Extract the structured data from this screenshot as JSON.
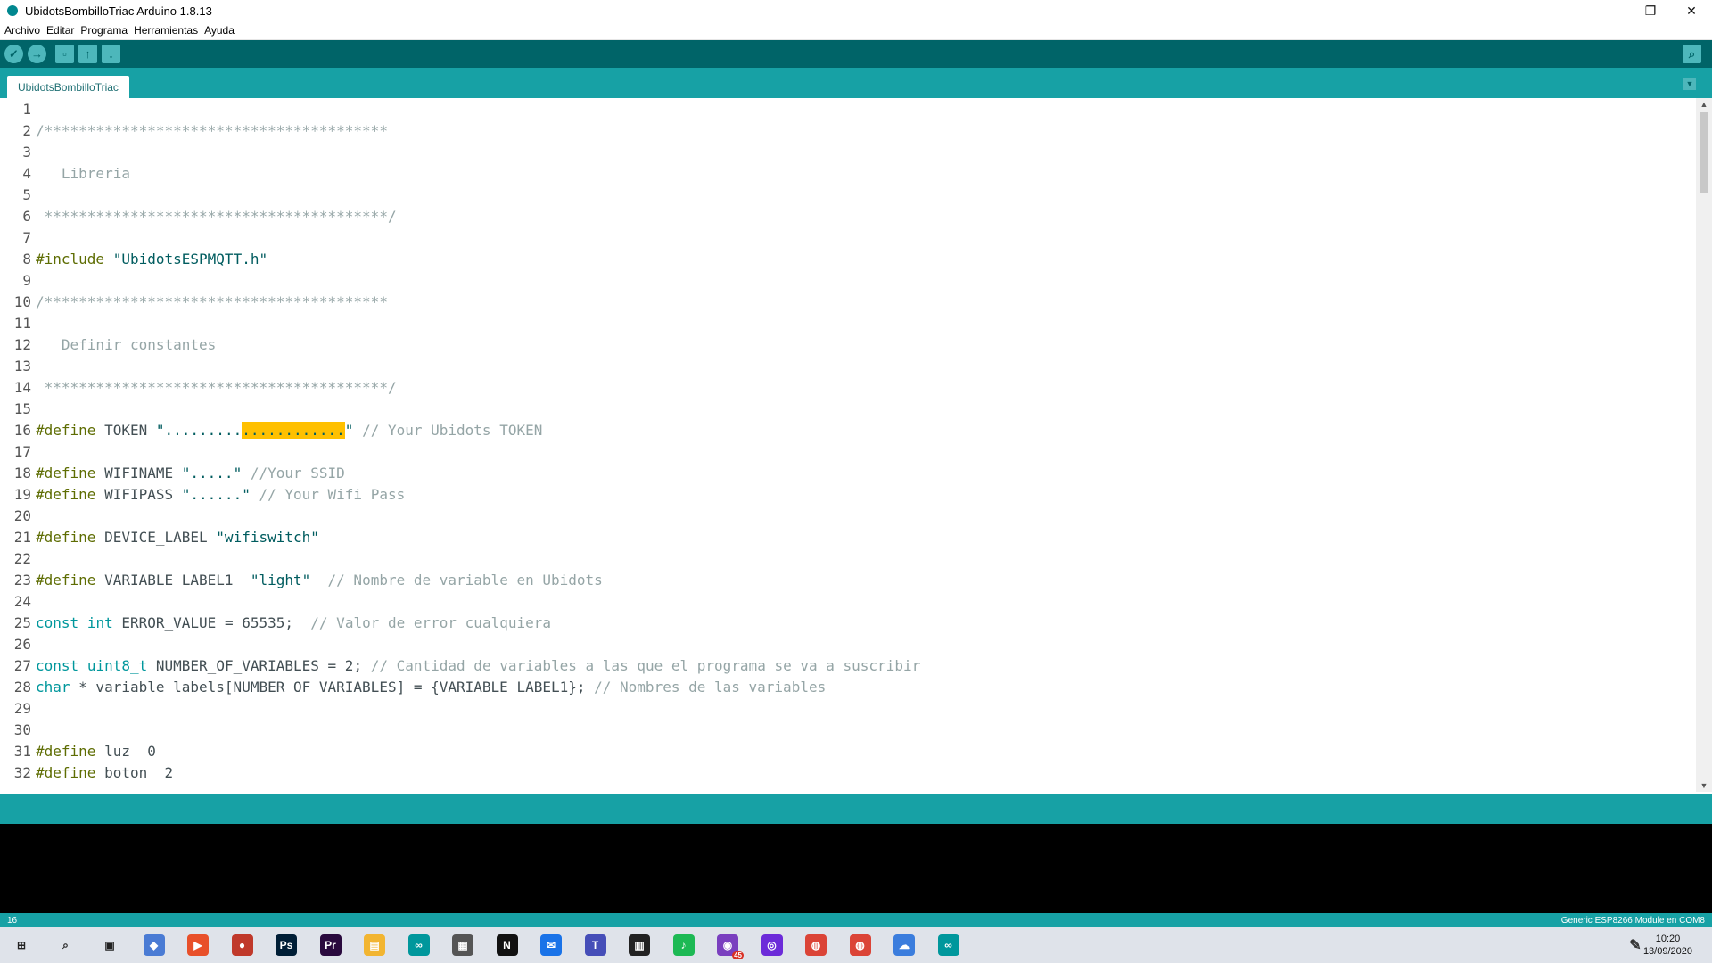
{
  "window": {
    "title": "UbidotsBombilloTriac Arduino 1.8.13",
    "controls": [
      "–",
      "❐",
      "✕"
    ]
  },
  "menu": [
    "Archivo",
    "Editar",
    "Programa",
    "Herramientas",
    "Ayuda"
  ],
  "toolbar": {
    "icons": [
      "verify-icon",
      "upload-icon",
      "new-icon",
      "open-icon",
      "save-icon",
      "serial-monitor-icon"
    ]
  },
  "tabs": [
    {
      "label": "UbidotsBombilloTriac"
    }
  ],
  "editor": {
    "lines": [
      {
        "n": "1",
        "segments": []
      },
      {
        "n": "2",
        "segments": [
          {
            "t": "/****************************************",
            "c": "cm"
          }
        ]
      },
      {
        "n": "3",
        "segments": []
      },
      {
        "n": "4",
        "segments": [
          {
            "t": "   Libreria",
            "c": "cm"
          }
        ]
      },
      {
        "n": "5",
        "segments": []
      },
      {
        "n": "6",
        "segments": [
          {
            "t": " ****************************************/",
            "c": "cm"
          }
        ]
      },
      {
        "n": "7",
        "segments": []
      },
      {
        "n": "8",
        "segments": [
          {
            "t": "#include",
            "c": "pp"
          },
          {
            "t": " ",
            "c": "code"
          },
          {
            "t": "\"UbidotsESPMQTT.h\"",
            "c": "str"
          }
        ]
      },
      {
        "n": "9",
        "segments": []
      },
      {
        "n": "10",
        "segments": [
          {
            "t": "/****************************************",
            "c": "cm"
          }
        ]
      },
      {
        "n": "11",
        "segments": []
      },
      {
        "n": "12",
        "segments": [
          {
            "t": "   Definir constantes",
            "c": "cm"
          }
        ]
      },
      {
        "n": "13",
        "segments": []
      },
      {
        "n": "14",
        "segments": [
          {
            "t": " ****************************************/",
            "c": "cm"
          }
        ]
      },
      {
        "n": "15",
        "segments": []
      },
      {
        "n": "16",
        "segments": [
          {
            "t": "#define",
            "c": "pp"
          },
          {
            "t": " TOKEN ",
            "c": "code"
          },
          {
            "t": "\".........",
            "c": "str"
          },
          {
            "t": "............",
            "c": "str hl"
          },
          {
            "t": "\"",
            "c": "str"
          },
          {
            "t": " // Your Ubidots TOKEN",
            "c": "cm"
          }
        ]
      },
      {
        "n": "17",
        "segments": []
      },
      {
        "n": "18",
        "segments": [
          {
            "t": "#define",
            "c": "pp"
          },
          {
            "t": " WIFINAME ",
            "c": "code"
          },
          {
            "t": "\".....\"",
            "c": "str"
          },
          {
            "t": " //Your SSID",
            "c": "cm"
          }
        ]
      },
      {
        "n": "19",
        "segments": [
          {
            "t": "#define",
            "c": "pp"
          },
          {
            "t": " WIFIPASS ",
            "c": "code"
          },
          {
            "t": "\"......\"",
            "c": "str"
          },
          {
            "t": " // Your Wifi Pass",
            "c": "cm"
          }
        ]
      },
      {
        "n": "20",
        "segments": []
      },
      {
        "n": "21",
        "segments": [
          {
            "t": "#define",
            "c": "pp"
          },
          {
            "t": " DEVICE_LABEL ",
            "c": "code"
          },
          {
            "t": "\"wifiswitch\"",
            "c": "str"
          }
        ]
      },
      {
        "n": "22",
        "segments": []
      },
      {
        "n": "23",
        "segments": [
          {
            "t": "#define",
            "c": "pp"
          },
          {
            "t": " VARIABLE_LABEL1  ",
            "c": "code"
          },
          {
            "t": "\"light\"",
            "c": "str"
          },
          {
            "t": "  // Nombre de variable en Ubidots",
            "c": "cm"
          }
        ]
      },
      {
        "n": "24",
        "segments": []
      },
      {
        "n": "25",
        "segments": [
          {
            "t": "const",
            "c": "type"
          },
          {
            "t": " ",
            "c": "code"
          },
          {
            "t": "int",
            "c": "type"
          },
          {
            "t": " ERROR_VALUE = 65535;",
            "c": "code"
          },
          {
            "t": "  // Valor de error cualquiera",
            "c": "cm"
          }
        ]
      },
      {
        "n": "26",
        "segments": []
      },
      {
        "n": "27",
        "segments": [
          {
            "t": "const",
            "c": "type"
          },
          {
            "t": " ",
            "c": "code"
          },
          {
            "t": "uint8_t",
            "c": "type"
          },
          {
            "t": " NUMBER_OF_VARIABLES = 2;",
            "c": "code"
          },
          {
            "t": " // Cantidad de variables a las que el programa se va a suscribir",
            "c": "cm"
          }
        ]
      },
      {
        "n": "28",
        "segments": [
          {
            "t": "char",
            "c": "type"
          },
          {
            "t": " * variable_labels[NUMBER_OF_VARIABLES] = {VARIABLE_LABEL1};",
            "c": "code"
          },
          {
            "t": " // Nombres de las variables",
            "c": "cm"
          }
        ]
      },
      {
        "n": "29",
        "segments": []
      },
      {
        "n": "30",
        "segments": []
      },
      {
        "n": "31",
        "segments": [
          {
            "t": "#define",
            "c": "pp"
          },
          {
            "t": " luz  0",
            "c": "code"
          }
        ]
      },
      {
        "n": "32",
        "segments": [
          {
            "t": "#define",
            "c": "pp"
          },
          {
            "t": " boton  2",
            "c": "code"
          }
        ]
      }
    ]
  },
  "status": {
    "line_number": "16",
    "board": "Generic ESP8266 Module en COM8"
  },
  "taskbar": {
    "apps": [
      "windows-start-icon",
      "search-icon",
      "task-view-icon",
      "app-icon",
      "app-icon",
      "app-icon",
      "photoshop-icon",
      "premiere-icon",
      "file-explorer-icon",
      "arduino-icon",
      "store-icon",
      "netflix-icon",
      "mail-icon",
      "teams-icon",
      "app-icon",
      "spotify-icon",
      "app-icon",
      "app-icon",
      "chrome-icon",
      "chrome-icon",
      "app-icon",
      "arduino-icon"
    ],
    "badge": "45",
    "time": "10:20",
    "date": "13/09/2020"
  }
}
